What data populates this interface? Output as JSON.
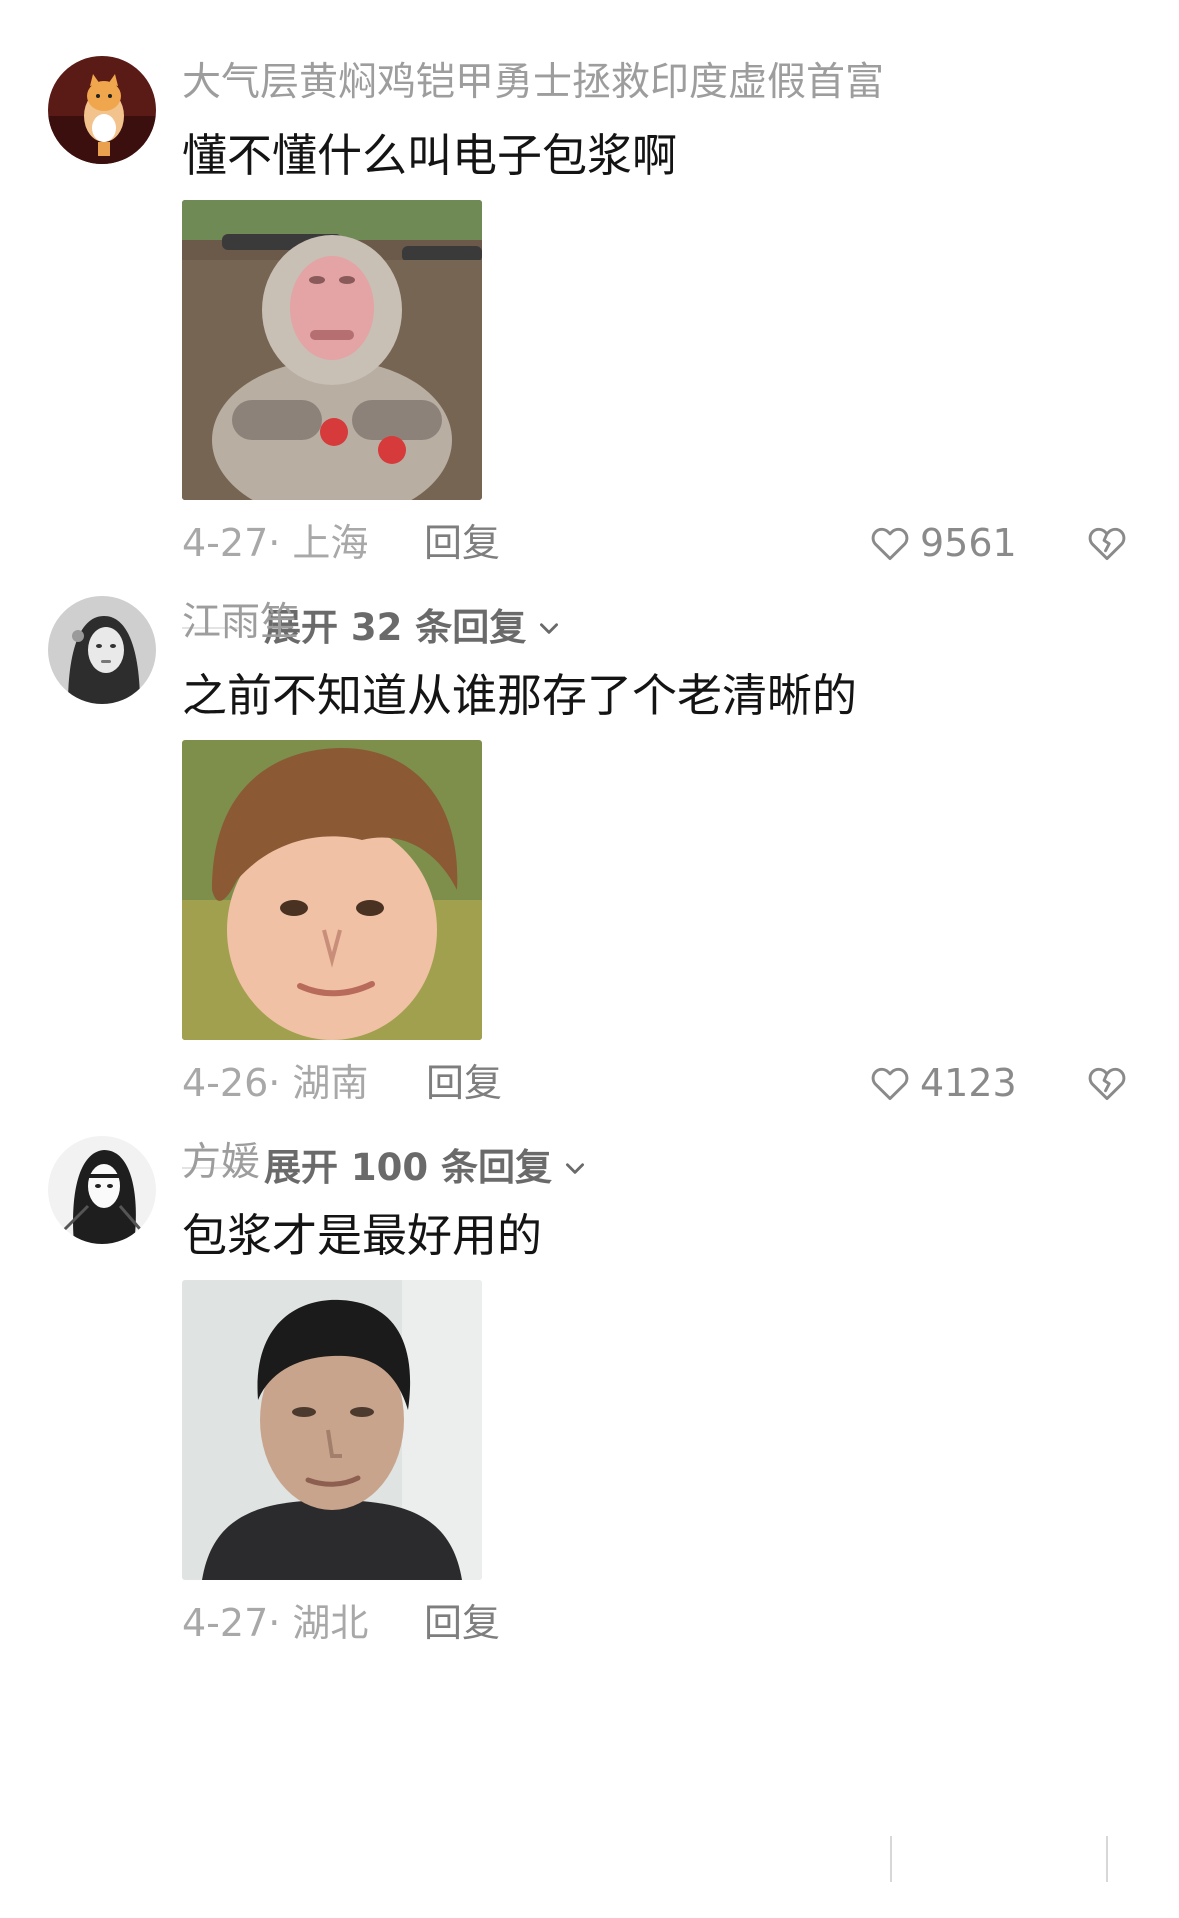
{
  "comments": [
    {
      "username": "大气层黄焖鸡铠甲勇士拯救印度虚假首富",
      "text": "懂不懂什么叫电子包浆啊",
      "sticker": "monkey-meme-image",
      "date": "4-27",
      "location": "上海",
      "date_location": "4-27· 上海",
      "reply_label": "回复",
      "likes": "9561",
      "expand_label": "展开 32 条回复"
    },
    {
      "username": "江雨笙",
      "text": "之前不知道从谁那存了个老清晰的",
      "sticker": "smirking-boy-meme-image",
      "date": "4-26",
      "location": "湖南",
      "date_location": "4-26· 湖南",
      "reply_label": "回复",
      "likes": "4123",
      "expand_label": "展开 100 条回复"
    },
    {
      "username": "方媛",
      "text": "包浆才是最好用的",
      "sticker": "man-portrait-meme-image",
      "date": "4-27",
      "location": "湖北",
      "date_location": "4-27· 湖北",
      "reply_label": "回复"
    }
  ],
  "icons": {
    "like": "heart-outline-icon",
    "dislike": "broken-heart-icon",
    "expand": "chevron-down-icon"
  },
  "colors": {
    "username": "#9d9d9d",
    "text": "#141414",
    "meta": "#a8a8a8"
  }
}
